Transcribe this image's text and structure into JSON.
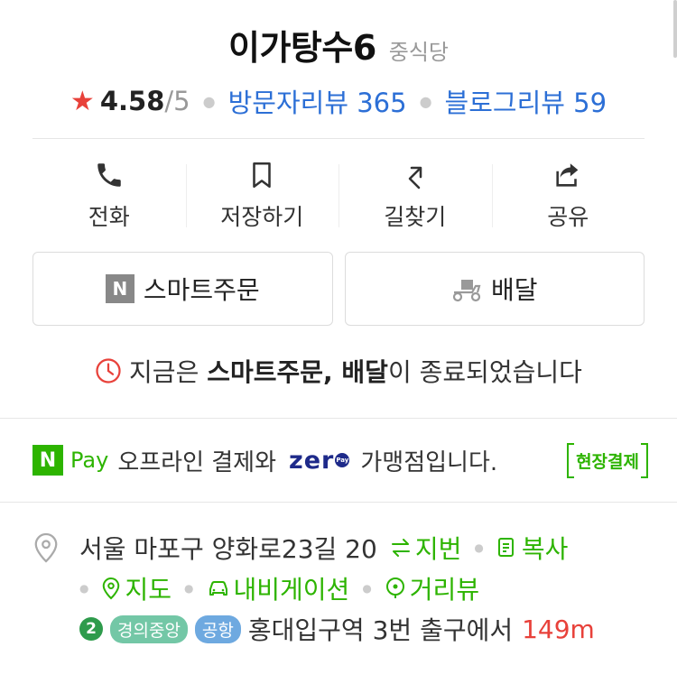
{
  "place": {
    "name": "이가탕수6",
    "category": "중식당"
  },
  "rating": {
    "star": "★",
    "score": "4.58",
    "max": "/5"
  },
  "reviews": {
    "visit": "방문자리뷰 365",
    "blog": "블로그리뷰 59"
  },
  "actions": [
    {
      "label": "전화",
      "icon": "phone-icon"
    },
    {
      "label": "저장하기",
      "icon": "bookmark-icon"
    },
    {
      "label": "길찾기",
      "icon": "directions-icon"
    },
    {
      "label": "공유",
      "icon": "share-icon"
    }
  ],
  "order_buttons": {
    "smart_badge": "N",
    "smart": "스마트주문",
    "delivery": "배달"
  },
  "notice": {
    "prefix": "지금은 ",
    "bold": "스마트주문, 배달",
    "suffix": "이 종료되었습니다"
  },
  "pay": {
    "npay_badge": "N",
    "npay_text": "Pay",
    "text1": "오프라인 결제와",
    "zero_text": "zer",
    "zero_badge": "Pay",
    "text2": "가맹점입니다.",
    "onsite": "현장결제"
  },
  "address": {
    "text": "서울 마포구 양화로23길 20",
    "jibun": "지번",
    "copy": "복사",
    "map": "지도",
    "navi": "내비게이션",
    "street": "거리뷰"
  },
  "transit": {
    "line": "2",
    "badge1": "경의중앙",
    "badge2": "공항",
    "station": "홍대입구역 3번 출구에서",
    "distance": "149m"
  },
  "colors": {
    "accent_green": "#2db400",
    "link_blue": "#2c6fd6",
    "star_red": "#e8413a"
  }
}
